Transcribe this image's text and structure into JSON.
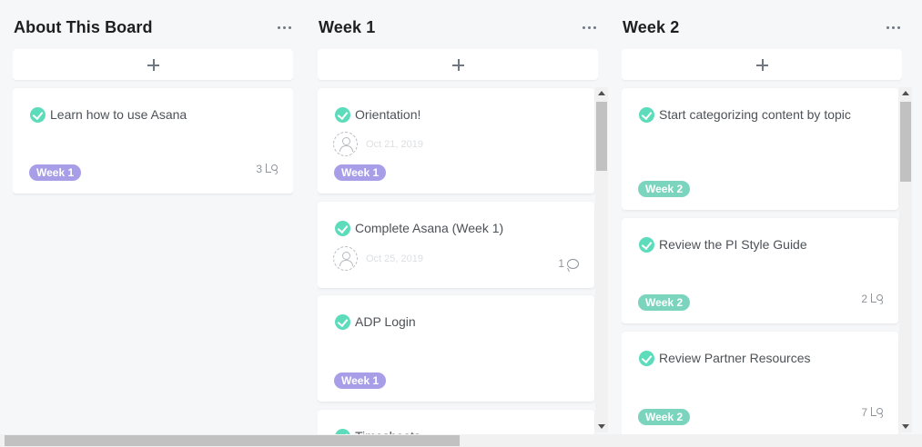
{
  "columns": [
    {
      "title": "About This Board",
      "cards": [
        {
          "name": "Learn how to use Asana",
          "tag": "Week 1",
          "subtasks": "3"
        }
      ]
    },
    {
      "title": "Week 1",
      "cards": [
        {
          "name": "Orientation!",
          "due": "Oct 21, 2019",
          "tag": "Week 1"
        },
        {
          "name": "Complete Asana (Week 1)",
          "due": "Oct 25, 2019",
          "comments": "1"
        },
        {
          "name": "ADP Login",
          "tag": "Week 1"
        },
        {
          "name": "Timesheets"
        }
      ]
    },
    {
      "title": "Week 2",
      "cards": [
        {
          "name": "Start categorizing content by topic",
          "tag": "Week 2"
        },
        {
          "name": "Review the PI Style Guide",
          "tag": "Week 2",
          "subtasks": "2"
        },
        {
          "name": "Review Partner Resources",
          "tag": "Week 2",
          "subtasks": "7"
        }
      ]
    }
  ],
  "icons": {
    "more": "more-icon",
    "add": "plus-icon",
    "complete": "check-circle-icon",
    "assignee": "user-icon",
    "subtasks": "subtask-icon",
    "comments": "comment-icon"
  },
  "colors": {
    "check": "#5ddcbc",
    "tag_week1": "#a89ee8",
    "tag_week2": "#7bd4bd",
    "background": "#f6f7f9"
  }
}
